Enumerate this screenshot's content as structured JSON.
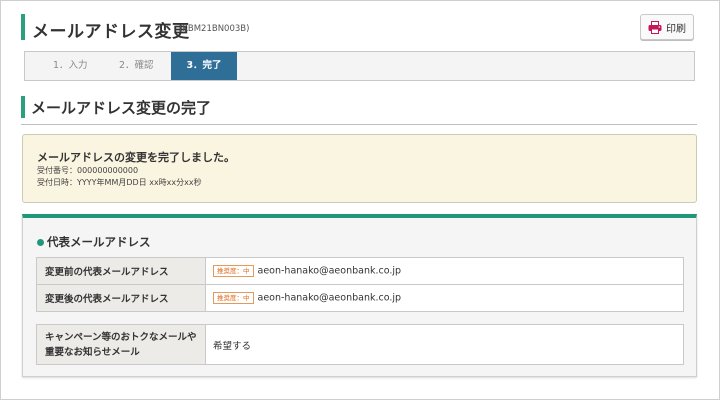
{
  "header": {
    "title": "メールアドレス変更",
    "code": "(KBM21BN003B)",
    "print_label": "印刷"
  },
  "steps": [
    {
      "label": "1．入力",
      "active": false
    },
    {
      "label": "2．確認",
      "active": false
    },
    {
      "label": "3．完了",
      "active": true
    }
  ],
  "section": {
    "title": "メールアドレス変更の完了"
  },
  "notice": {
    "title": "メールアドレスの変更を完了しました。",
    "line1": "受付番号：000000000000",
    "line2": "受付日時：YYYY年MM月DD日 xx時xx分xx秒"
  },
  "card": {
    "heading": "代表メールアドレス",
    "rows": [
      {
        "label": "変更前の代表メールアドレス",
        "badge": "推奨度：中",
        "value": "aeon-hanako@aeonbank.co.jp"
      },
      {
        "label": "変更後の代表メールアドレス",
        "badge": "推奨度：中",
        "value": "aeon-hanako@aeonbank.co.jp"
      }
    ],
    "campaign": {
      "label_line1": "キャンペーン等のおトクなメールや",
      "label_line2": "重要なお知らせメール",
      "value": "希望する"
    }
  },
  "colors": {
    "accent_green": "#20977a",
    "active_step": "#2f6f97",
    "print_icon": "#c2185b",
    "badge_orange": "#e06b1e",
    "notice_bg": "#faf5e1"
  },
  "icons": {
    "print": "printer-icon",
    "bullet": "dot-icon"
  }
}
